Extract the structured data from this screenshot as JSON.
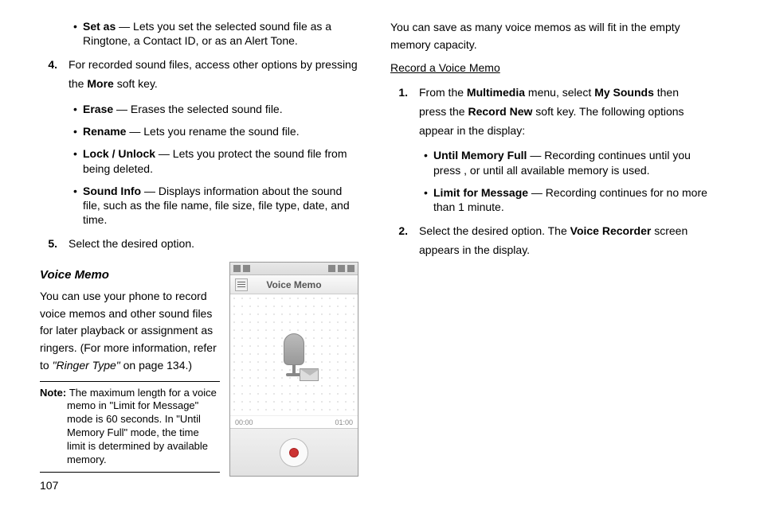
{
  "left": {
    "setas": {
      "label": "Set as",
      "desc": " — Lets you set the selected sound file as a Ringtone, a Contact ID, or as an Alert Tone."
    },
    "step4": {
      "num": "4.",
      "text1": "For recorded sound files, access other options by pressing the ",
      "bold": "More",
      "text2": " soft key."
    },
    "erase": {
      "label": "Erase",
      "desc": " — Erases the selected sound file."
    },
    "rename": {
      "label": "Rename",
      "desc": " — Lets you rename the sound file."
    },
    "lock": {
      "label": "Lock / Unlock",
      "desc": " — Lets you protect the sound file from being deleted."
    },
    "soundinfo": {
      "label": "Sound Info",
      "desc": " — Displays information about the sound file, such as the file name, file size, file type, date, and time."
    },
    "step5": {
      "num": "5.",
      "text": "Select the desired option."
    },
    "voice_memo_title": "Voice Memo",
    "voice_memo_para1": "You can use your phone to record voice memos and other sound files for later playback or assignment as ringers. (For more information, refer to ",
    "voice_memo_ref": "\"Ringer Type\"",
    "voice_memo_para2": "  on page 134.)",
    "note": {
      "label": "Note: ",
      "text": "The maximum length for a voice memo in \"Limit for Message\" mode is 60 seconds. In \"Until Memory Full\" mode, the time limit is determined by available memory."
    }
  },
  "phone": {
    "title": "Voice Memo",
    "t_left": "00:00",
    "t_right": "01:00"
  },
  "right": {
    "intro": "You can save as many voice memos as will fit in the empty memory capacity.",
    "subhead": "Record a Voice Memo",
    "step1": {
      "num": "1.",
      "t1": "From the ",
      "b1": "Multimedia",
      "t2": " menu, select ",
      "b2": "My Sounds",
      "t3": " then press the ",
      "b3": "Record New",
      "t4": " soft key. The following options appear in the display:"
    },
    "untilfull": {
      "label": "Until Memory Full",
      "desc": " — Recording continues until you press , or until all available memory is used."
    },
    "limitmsg": {
      "label": "Limit for Message",
      "desc": " — Recording continues for no more than 1 minute."
    },
    "step2": {
      "num": "2.",
      "t1": "Select the desired option. The ",
      "b1": "Voice Recorder",
      "t2": " screen appears in the display."
    }
  },
  "page_num": "107"
}
